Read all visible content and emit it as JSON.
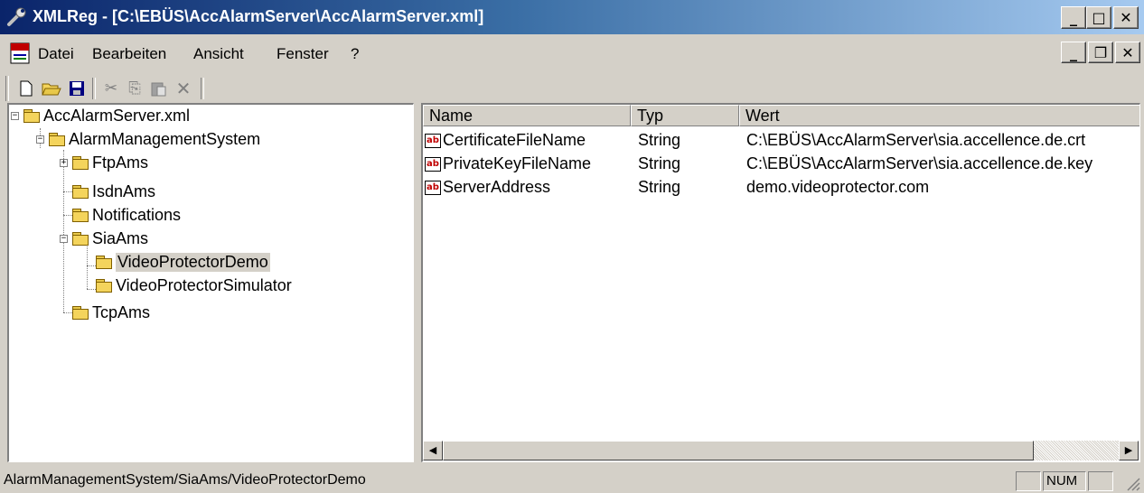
{
  "window": {
    "title": "XMLReg - [C:\\EBÜS\\AccAlarmServer\\AccAlarmServer.xml]",
    "app_icon": "wrench-icon",
    "caption_buttons": {
      "minimize": "_",
      "maximize": "□",
      "close": "✕"
    },
    "mdi_buttons": {
      "minimize": "_",
      "restore": "❐",
      "close": "✕"
    }
  },
  "menu": {
    "doc_icon": "document-icon",
    "items": [
      {
        "label": "Datei"
      },
      {
        "label": "Bearbeiten"
      },
      {
        "label": "Ansicht"
      },
      {
        "label": "Fenster"
      },
      {
        "label": "?"
      }
    ]
  },
  "toolbar": {
    "new_glyph": "🗋",
    "open_glyph": "📂",
    "save_glyph": "💾",
    "cut_glyph": "✂",
    "copy_glyph": "⎘",
    "paste_glyph": "📋",
    "delete_glyph": "✕"
  },
  "tree": {
    "expand_glyph": "+",
    "collapse_glyph": "−",
    "root": "AccAlarmServer.xml",
    "n1": "AlarmManagementSystem",
    "n2": "FtpAms",
    "n3": "IsdnAms",
    "n4": "Notifications",
    "n5": "SiaAms",
    "n6": "VideoProtectorDemo",
    "n7": "VideoProtectorSimulator",
    "n8": "TcpAms"
  },
  "list": {
    "columns": {
      "name": "Name",
      "type": "Typ",
      "value": "Wert"
    },
    "type_icon": "ab",
    "rows": [
      {
        "name": "CertificateFileName",
        "type": "String",
        "value": "C:\\EBÜS\\AccAlarmServer\\sia.accellence.de.crt"
      },
      {
        "name": "PrivateKeyFileName",
        "type": "String",
        "value": "C:\\EBÜS\\AccAlarmServer\\sia.accellence.de.key"
      },
      {
        "name": "ServerAddress",
        "type": "String",
        "value": "demo.videoprotector.com"
      }
    ]
  },
  "scrollbar": {
    "left_arrow": "◀",
    "right_arrow": "▶"
  },
  "statusbar": {
    "path": "AlarmManagementSystem/SiaAms/VideoProtectorDemo",
    "num": "NUM"
  }
}
